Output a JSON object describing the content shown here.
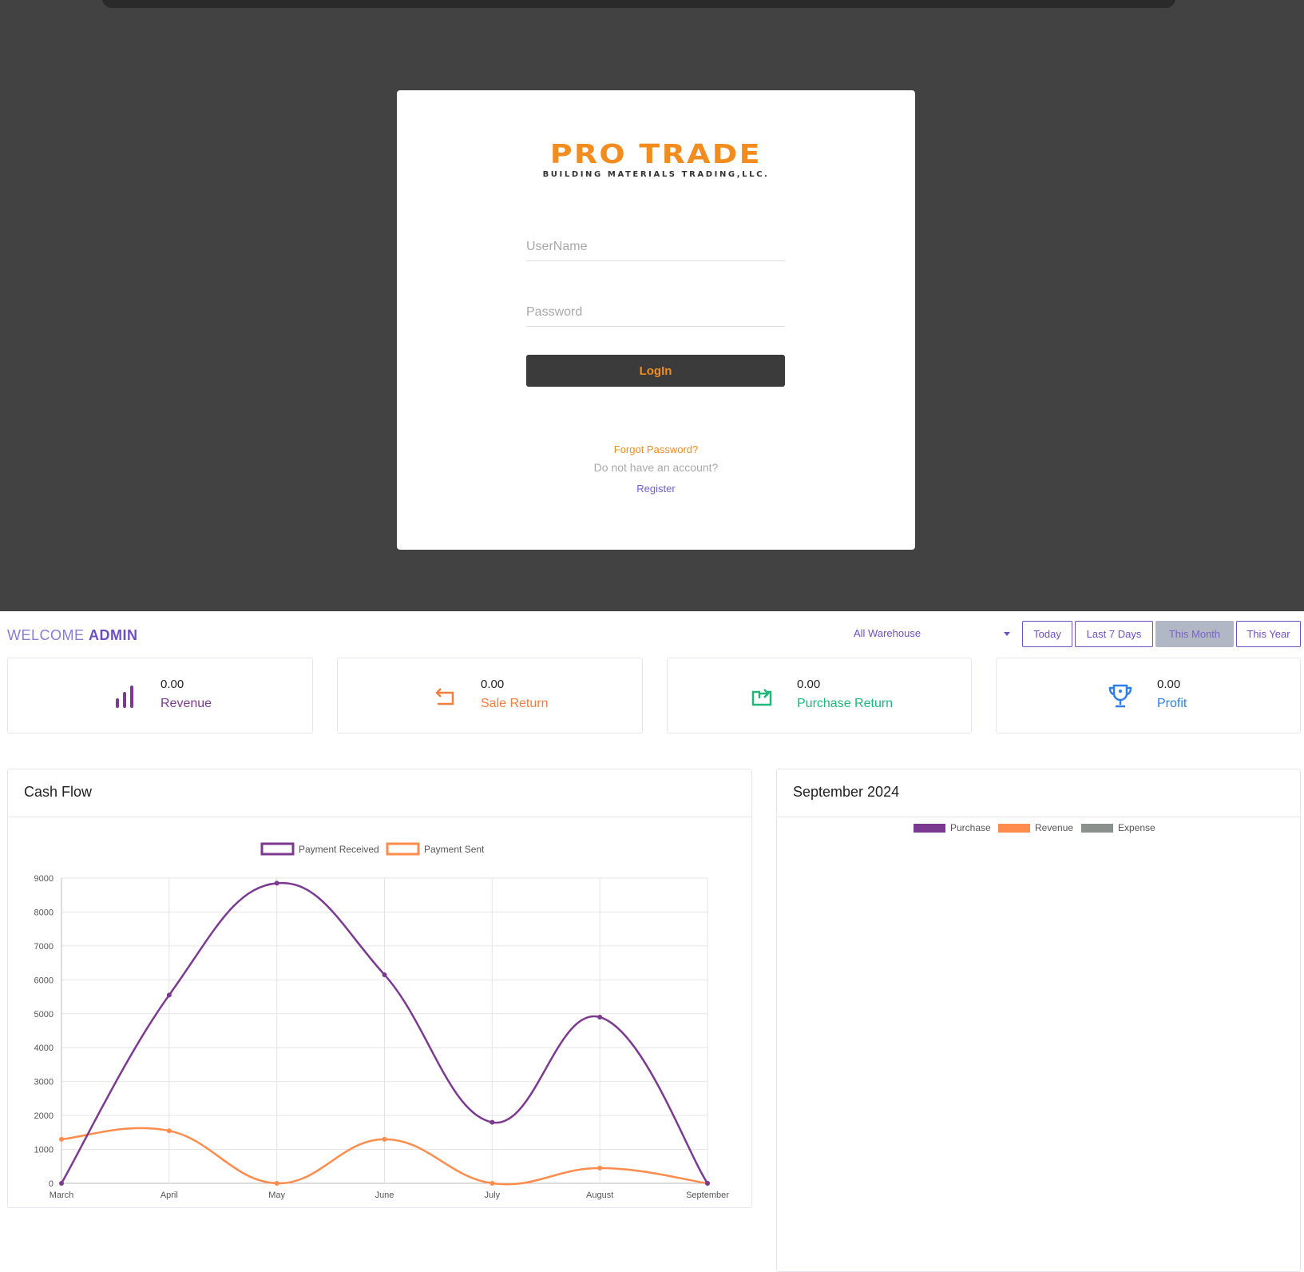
{
  "login": {
    "logo_main": "PRO TRADE",
    "logo_sub": "BUILDING MATERIALS TRADING,LLC.",
    "username_placeholder": "UserName",
    "password_placeholder": "Password",
    "login_label": "LogIn",
    "forgot_label": "Forgot Password?",
    "no_account_text": "Do not have an account?",
    "register_label": "Register"
  },
  "dashboard": {
    "welcome_prefix": "WELCOME",
    "welcome_user": "ADMIN",
    "warehouse_selected": "All Warehouse",
    "filters": [
      {
        "label": "Today",
        "active": false
      },
      {
        "label": "Last 7 Days",
        "active": false
      },
      {
        "label": "This Month",
        "active": true
      },
      {
        "label": "This Year",
        "active": false
      }
    ],
    "stats": [
      {
        "value": "0.00",
        "label": "Revenue",
        "color": "#7b3a8f",
        "icon": "bar-chart-icon"
      },
      {
        "value": "0.00",
        "label": "Sale Return",
        "color": "#f47c3c",
        "icon": "return-arrow-icon"
      },
      {
        "value": "0.00",
        "label": "Purchase Return",
        "color": "#1fb77a",
        "icon": "purchase-return-icon"
      },
      {
        "value": "0.00",
        "label": "Profit",
        "color": "#2f7fe6",
        "icon": "trophy-icon"
      }
    ],
    "cashflow_title": "Cash Flow",
    "month_panel_title": "September 2024",
    "month_legend": [
      {
        "name": "Purchase",
        "color": "#7b3a8f"
      },
      {
        "name": "Revenue",
        "color": "#ff8c4d"
      },
      {
        "name": "Expense",
        "color": "#8a918c"
      }
    ]
  },
  "chart_data": {
    "type": "line",
    "x": [
      "March",
      "April",
      "May",
      "June",
      "July",
      "August",
      "September"
    ],
    "series": [
      {
        "name": "Payment Received",
        "color": "#7b3a8f",
        "values": [
          0,
          5550,
          8850,
          6150,
          1800,
          4900,
          0
        ]
      },
      {
        "name": "Payment Sent",
        "color": "#ff8c4d",
        "values": [
          1300,
          1550,
          0,
          1300,
          0,
          450,
          0
        ]
      }
    ],
    "ylim": [
      0,
      9000
    ],
    "yticks": [
      0,
      1000,
      2000,
      3000,
      4000,
      5000,
      6000,
      7000,
      8000,
      9000
    ],
    "grid": true,
    "legend": "top"
  }
}
